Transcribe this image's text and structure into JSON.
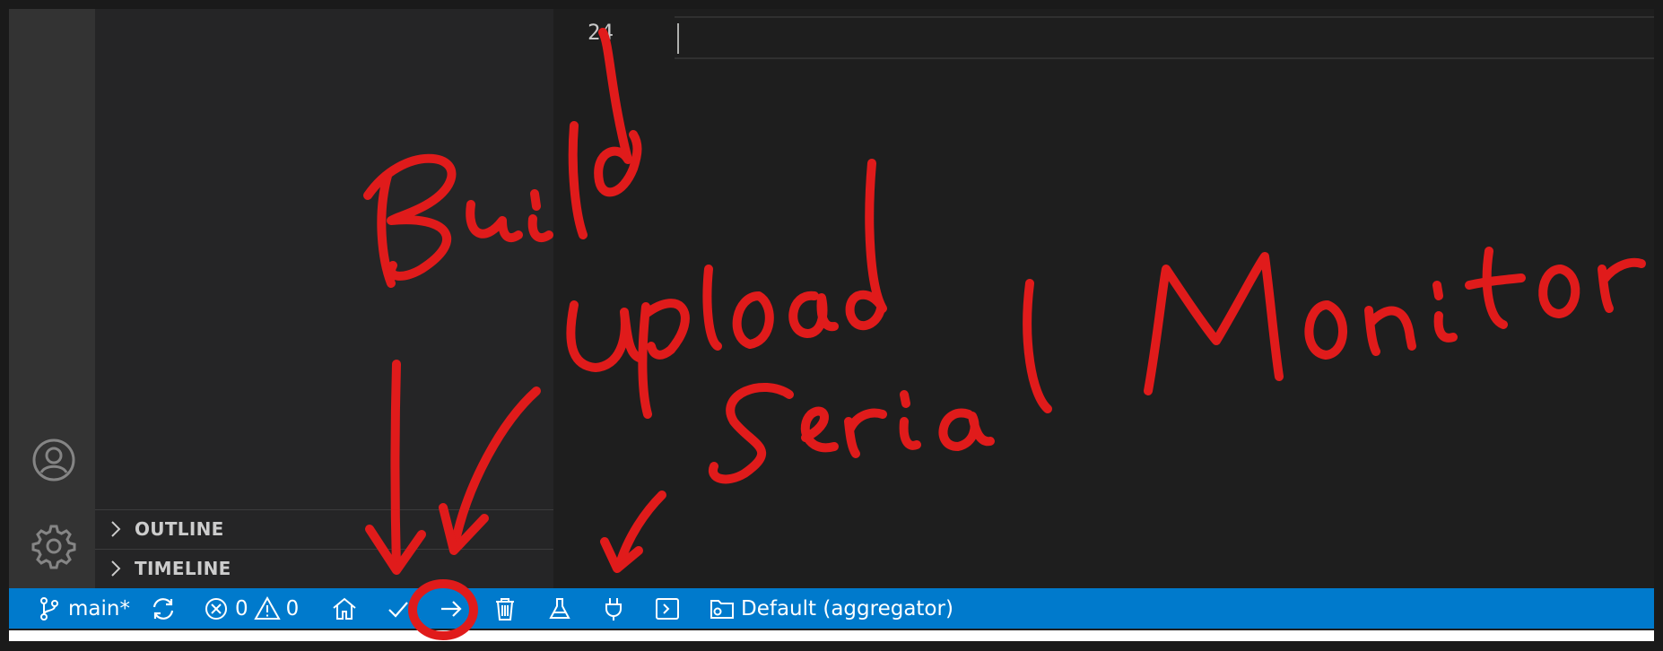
{
  "sidebar": {
    "panels": [
      {
        "label": "OUTLINE"
      },
      {
        "label": "TIMELINE"
      }
    ]
  },
  "activity_bar": {
    "icons": [
      "account-icon",
      "manage-gear-icon"
    ]
  },
  "editor": {
    "line_number": "24"
  },
  "status_bar": {
    "branch": "main*",
    "errors": "0",
    "warnings": "0",
    "project_env": "Default (aggregator)",
    "icons": [
      "git-branch-icon",
      "sync-icon",
      "error-icon",
      "warning-icon",
      "home-icon",
      "check-icon",
      "arrow-right-icon",
      "trash-icon",
      "flask-icon",
      "plug-icon",
      "terminal-icon",
      "folder-settings-icon"
    ]
  },
  "annotations": {
    "build": "Build",
    "upload": "Upload",
    "serial_monitor": "Serial Monitor",
    "color": "#e01b1b"
  },
  "colors": {
    "status_bar": "#007acc",
    "activity_bar": "#333333",
    "sidebar": "#252526",
    "editor": "#1e1e1e"
  }
}
